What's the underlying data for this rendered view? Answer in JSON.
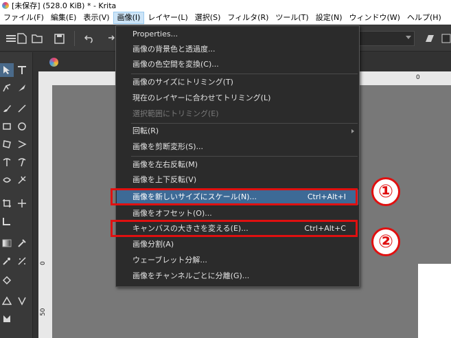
{
  "window": {
    "title": "[未保存]  (528.0 KiB)  * - Krita"
  },
  "menubar": {
    "items": [
      "ファイル(F)",
      "編集(E)",
      "表示(V)",
      "画像(I)",
      "レイヤー(L)",
      "選択(S)",
      "フィルタ(R)",
      "ツール(T)",
      "設定(N)",
      "ウィンドウ(W)",
      "ヘルプ(H)"
    ],
    "active": "画像(I)"
  },
  "image_menu": {
    "items": [
      {
        "label": "Properties...",
        "enabled": true
      },
      {
        "label": "画像の背景色と透過度...",
        "enabled": true
      },
      {
        "label": "画像の色空間を変換(C)...",
        "enabled": true
      },
      {
        "label": "画像のサイズにトリミング(T)",
        "enabled": true
      },
      {
        "label": "現在のレイヤーに合わせてトリミング(L)",
        "enabled": true
      },
      {
        "label": "選択範囲にトリミング(E)",
        "enabled": false
      },
      {
        "label": "回転(R)",
        "enabled": true,
        "submenu": true
      },
      {
        "label": "画像を剪断変形(S)...",
        "enabled": true
      },
      {
        "label": "画像を左右反転(M)",
        "enabled": true
      },
      {
        "label": "画像を上下反転(V)",
        "enabled": true
      },
      {
        "label": "画像を新しいサイズにスケール(N)...",
        "enabled": true,
        "shortcut": "Ctrl+Alt+I",
        "highlighted": true
      },
      {
        "label": "画像をオフセット(O)...",
        "enabled": true
      },
      {
        "label": "キャンバスの大きさを変える(E)...",
        "enabled": true,
        "shortcut": "Ctrl+Alt+C"
      },
      {
        "label": "画像分割(A)",
        "enabled": true
      },
      {
        "label": "ウェーブレット分解...",
        "enabled": true
      },
      {
        "label": "画像をチャンネルごとに分離(G)...",
        "enabled": true
      }
    ]
  },
  "annotations": {
    "badge1": "①",
    "badge2": "②"
  },
  "ruler": {
    "v_labels": [
      "0",
      "50"
    ],
    "h_label": "0"
  },
  "colors": {
    "accent_highlight": "#3d6a96",
    "annotation_red": "#e01010"
  }
}
